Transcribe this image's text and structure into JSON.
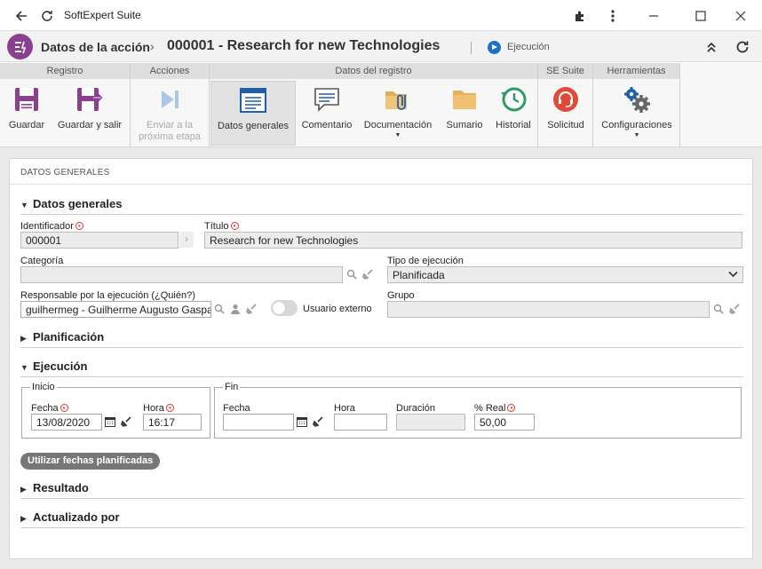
{
  "window": {
    "title": "SoftExpert Suite"
  },
  "header": {
    "logo_text": "E",
    "parent": "Datos de la acción",
    "separator": "›",
    "title": "000001 - Research for new Technologies",
    "status": "Ejecución"
  },
  "ribbon": {
    "groups": [
      "Registro",
      "Acciones",
      "Datos del registro",
      "SE Suite",
      "Herramientas"
    ],
    "buttons": {
      "guardar": "Guardar",
      "guardar_salir": "Guardar y salir",
      "enviar_line1": "Enviar a la",
      "enviar_line2": "próxima etapa",
      "datos_generales": "Datos generales",
      "comentario": "Comentario",
      "documentacion": "Documentación",
      "sumario": "Sumario",
      "historial": "Historial",
      "solicitud": "Solicitud",
      "configuraciones": "Configuraciones"
    }
  },
  "panel": {
    "title": "DATOS GENERALES",
    "sections": {
      "datos_generales": "Datos generales",
      "planificacion": "Planificación",
      "ejecucion": "Ejecución",
      "resultado": "Resultado",
      "actualizado_por": "Actualizado por"
    },
    "fields": {
      "identificador_label": "Identificador",
      "identificador_value": "000001",
      "titulo_label": "Título",
      "titulo_value": "Research for new Technologies",
      "categoria_label": "Categoría",
      "categoria_value": "",
      "tipo_label": "Tipo de ejecución",
      "tipo_value": "Planificada",
      "responsable_label": "Responsable por la ejecución (¿Quién?)",
      "responsable_value": "guilhermeg - Guilherme Augusto Gaspar",
      "usuario_externo_label": "Usuario externo",
      "grupo_label": "Grupo",
      "grupo_value": ""
    },
    "ejecucion": {
      "inicio_legend": "Inicio",
      "fin_legend": "Fin",
      "fecha_label": "Fecha",
      "hora_label": "Hora",
      "duracion_label": "Duración",
      "real_label": "% Real",
      "inicio_fecha": "13/08/2020",
      "inicio_hora": "16:17",
      "fin_fecha": "",
      "fin_hora": "",
      "duracion": "",
      "real": "50,00",
      "usar_fechas_button": "Utilizar fechas planificadas"
    }
  },
  "colors": {
    "brand": "#8b3f8f",
    "status_blue": "#1a73c9",
    "required": "#d33333"
  }
}
